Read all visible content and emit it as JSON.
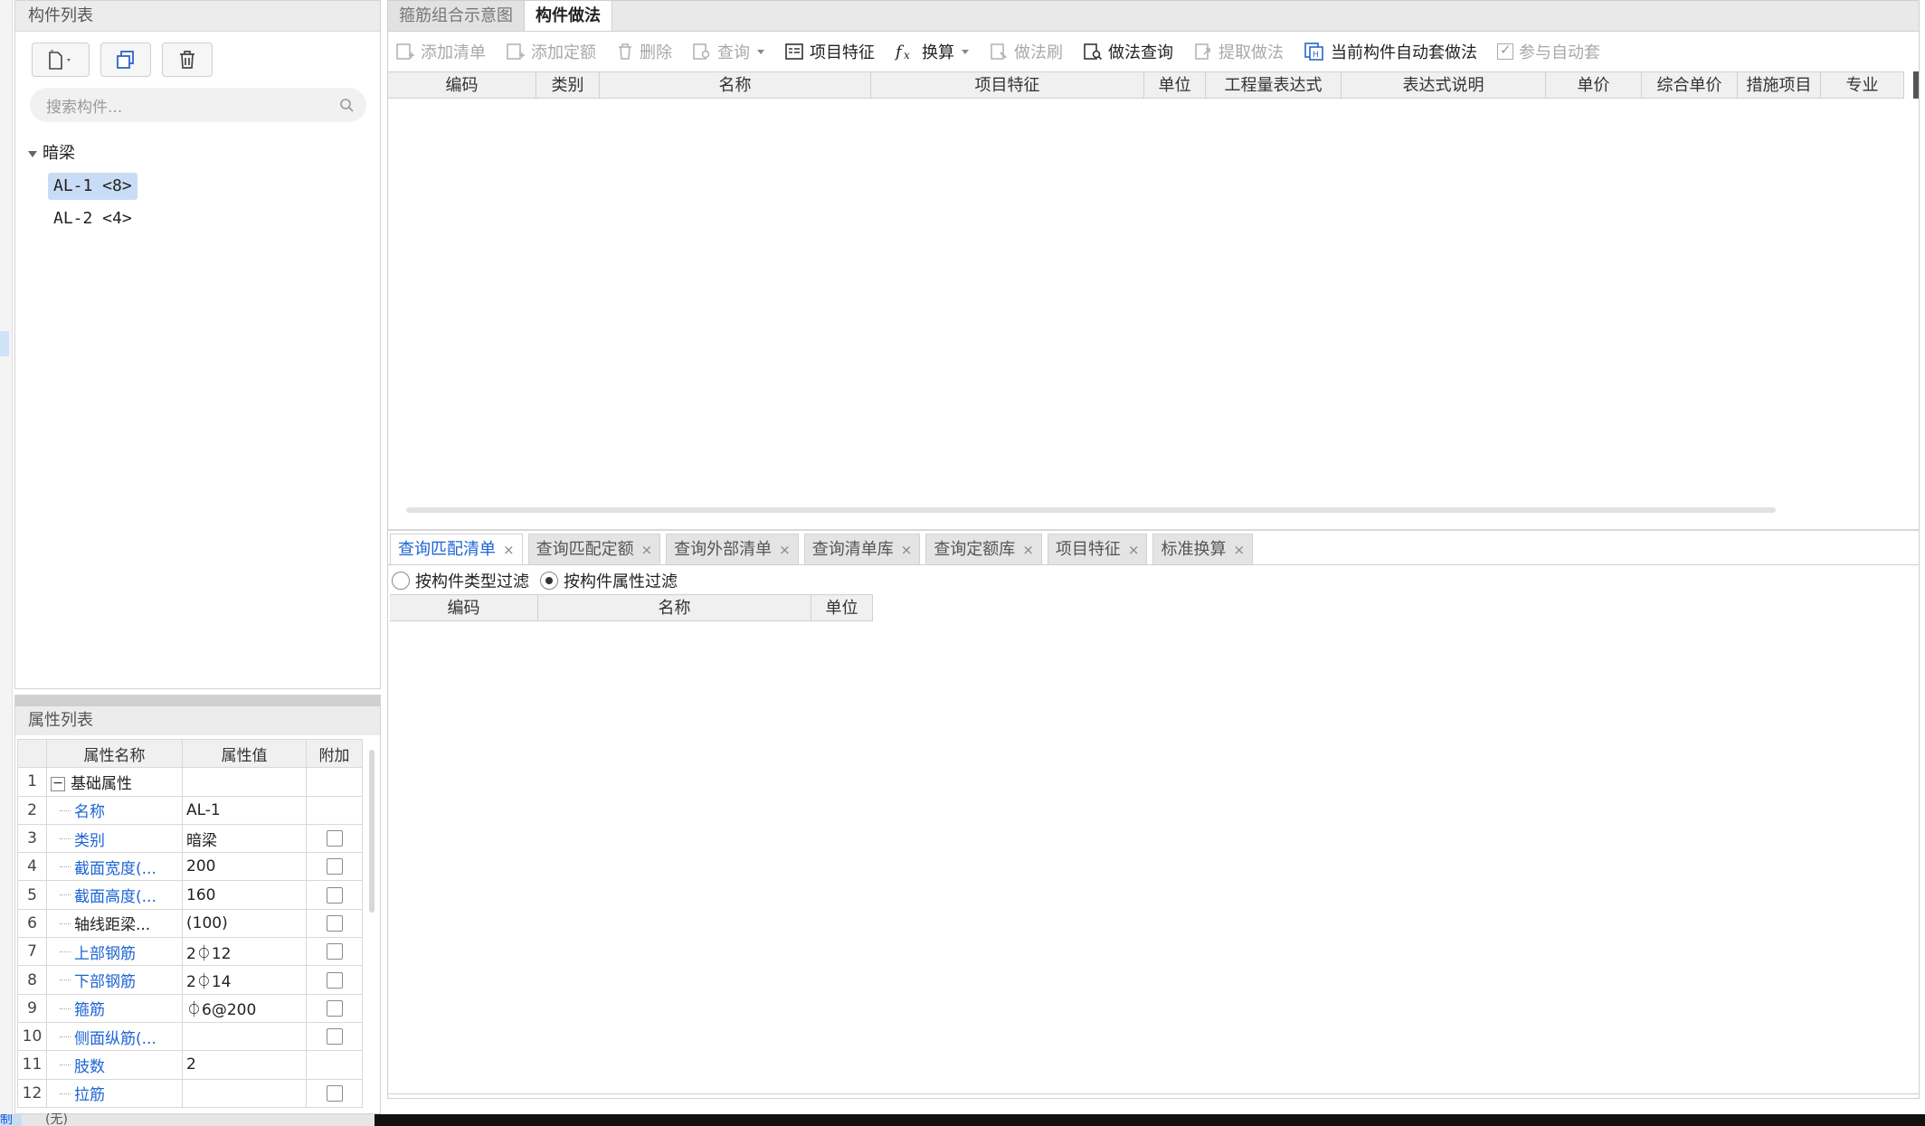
{
  "left_panel": {
    "title": "构件列表",
    "search_placeholder": "搜索构件...",
    "tree": {
      "root": "暗梁",
      "items": [
        "AL-1 <8>",
        "AL-2 <4>"
      ]
    }
  },
  "props_panel": {
    "title": "属性列表",
    "headers": [
      "属性名称",
      "属性值",
      "附加"
    ],
    "rows": [
      {
        "num": "1",
        "name": "基础属性",
        "value": "",
        "group": true
      },
      {
        "num": "2",
        "name": "名称",
        "value": "AL-1",
        "blue": true,
        "checkbox": false
      },
      {
        "num": "3",
        "name": "类别",
        "value": "暗梁",
        "blue": true,
        "checkbox": true
      },
      {
        "num": "4",
        "name": "截面宽度(...",
        "value": "200",
        "blue": true,
        "checkbox": true
      },
      {
        "num": "5",
        "name": "截面高度(...",
        "value": "160",
        "blue": true,
        "checkbox": true
      },
      {
        "num": "6",
        "name": "轴线距梁...",
        "value": "(100)",
        "blue": false,
        "checkbox": true
      },
      {
        "num": "7",
        "name": "上部钢筋",
        "value": "2⏀12",
        "blue": true,
        "checkbox": true
      },
      {
        "num": "8",
        "name": "下部钢筋",
        "value": "2⏀14",
        "blue": true,
        "checkbox": true
      },
      {
        "num": "9",
        "name": "箍筋",
        "value": "⏀6@200",
        "blue": true,
        "checkbox": true
      },
      {
        "num": "10",
        "name": "侧面纵筋(...",
        "value": "",
        "blue": true,
        "checkbox": true
      },
      {
        "num": "11",
        "name": "肢数",
        "value": "2",
        "blue": true,
        "checkbox": false
      },
      {
        "num": "12",
        "name": "拉筋",
        "value": "",
        "blue": true,
        "checkbox": true
      }
    ]
  },
  "status": {
    "left": "制",
    "text": "(无)"
  },
  "top_tabs": [
    {
      "label": "箍筋组合示意图",
      "active": false
    },
    {
      "label": "构件做法",
      "active": true
    }
  ],
  "toolbar": {
    "add_list": "添加清单",
    "add_quota": "添加定额",
    "delete": "删除",
    "query": "查询",
    "item_feature": "项目特征",
    "convert": "换算",
    "method_brush": "做法刷",
    "method_query": "做法查询",
    "extract_method": "提取做法",
    "auto_apply": "当前构件自动套做法",
    "join_auto": "参与自动套"
  },
  "grid_headers": [
    "编码",
    "类别",
    "名称",
    "项目特征",
    "单位",
    "工程量表达式",
    "表达式说明",
    "单价",
    "综合单价",
    "措施项目",
    "专业"
  ],
  "bottom_tabs": [
    "查询匹配清单",
    "查询匹配定额",
    "查询外部清单",
    "查询清单库",
    "查询定额库",
    "项目特征",
    "标准换算"
  ],
  "filters": {
    "by_type": "按构件类型过滤",
    "by_attr": "按构件属性过滤"
  },
  "grid2_headers": [
    "编码",
    "名称",
    "单位"
  ]
}
